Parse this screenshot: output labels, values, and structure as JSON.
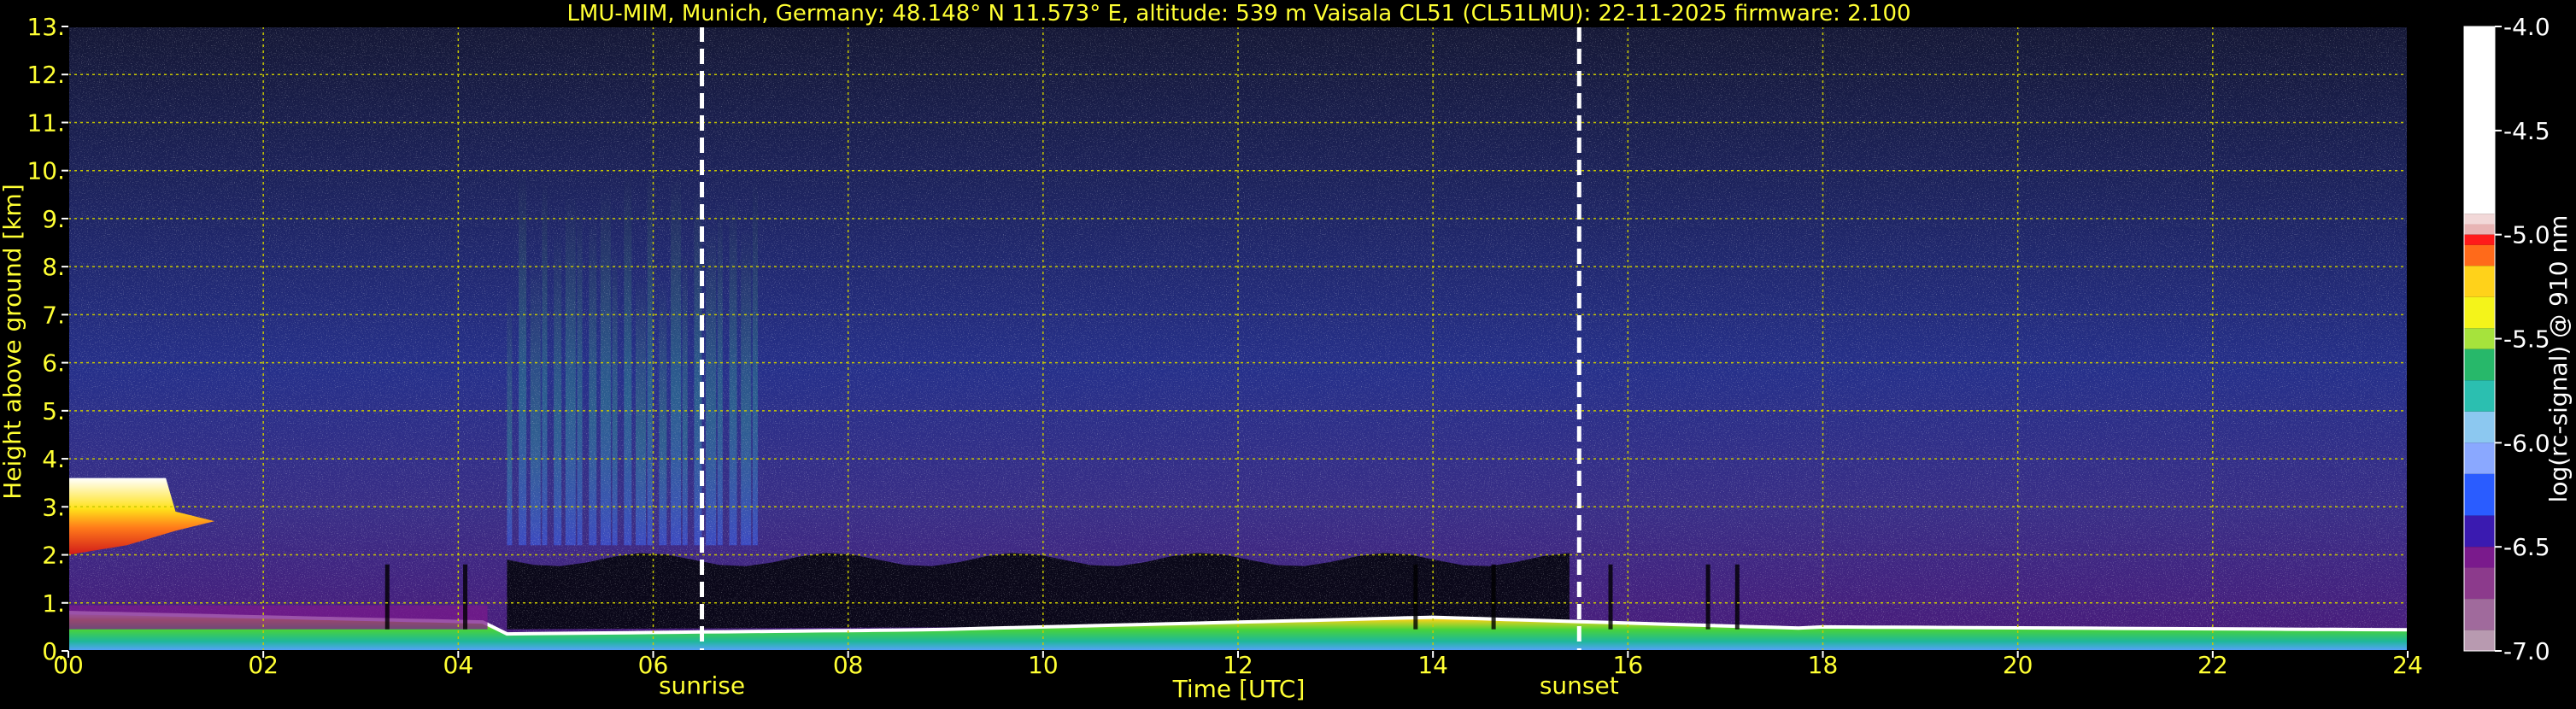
{
  "chart_data": {
    "type": "heatmap",
    "title": "LMU-MIM, Munich, Germany; 48.148° N 11.573° E, altitude: 539 m    Vaisala CL51 (CL51LMU): 22-11-2025    firmware: 2.100",
    "xlabel": "Time [UTC]",
    "ylabel": "Height above ground [km]",
    "xlim": [
      0,
      24
    ],
    "ylim": [
      0,
      13
    ],
    "x_tick_labels": [
      "00",
      "02",
      "04",
      "06",
      "08",
      "10",
      "12",
      "14",
      "16",
      "18",
      "20",
      "22",
      "24"
    ],
    "y_tick_labels": [
      "0.",
      "1.",
      "2.",
      "3.",
      "4.",
      "5.",
      "6.",
      "7.",
      "8.",
      "9.",
      "10.",
      "11.",
      "12.",
      "13."
    ],
    "grid": true,
    "colorbar": {
      "label": "log(rc-signal) @ 910 nm",
      "range": [
        -7.0,
        -4.0
      ],
      "tick_labels": [
        "-4.0",
        "-4.5",
        "-5.0",
        "-5.5",
        "-6.0",
        "-6.5",
        "-7.0"
      ],
      "tick_values": [
        -4.0,
        -4.5,
        -5.0,
        -5.5,
        -6.0,
        -6.5,
        -7.0
      ]
    },
    "markers": [
      {
        "label": "sunrise",
        "time_utc": 6.5
      },
      {
        "label": "sunset",
        "time_utc": 15.5
      }
    ],
    "colors": {
      "text": "#ffff33",
      "grid": "#c8c800",
      "background": "#000000",
      "marker_line": "#ffffff"
    }
  }
}
